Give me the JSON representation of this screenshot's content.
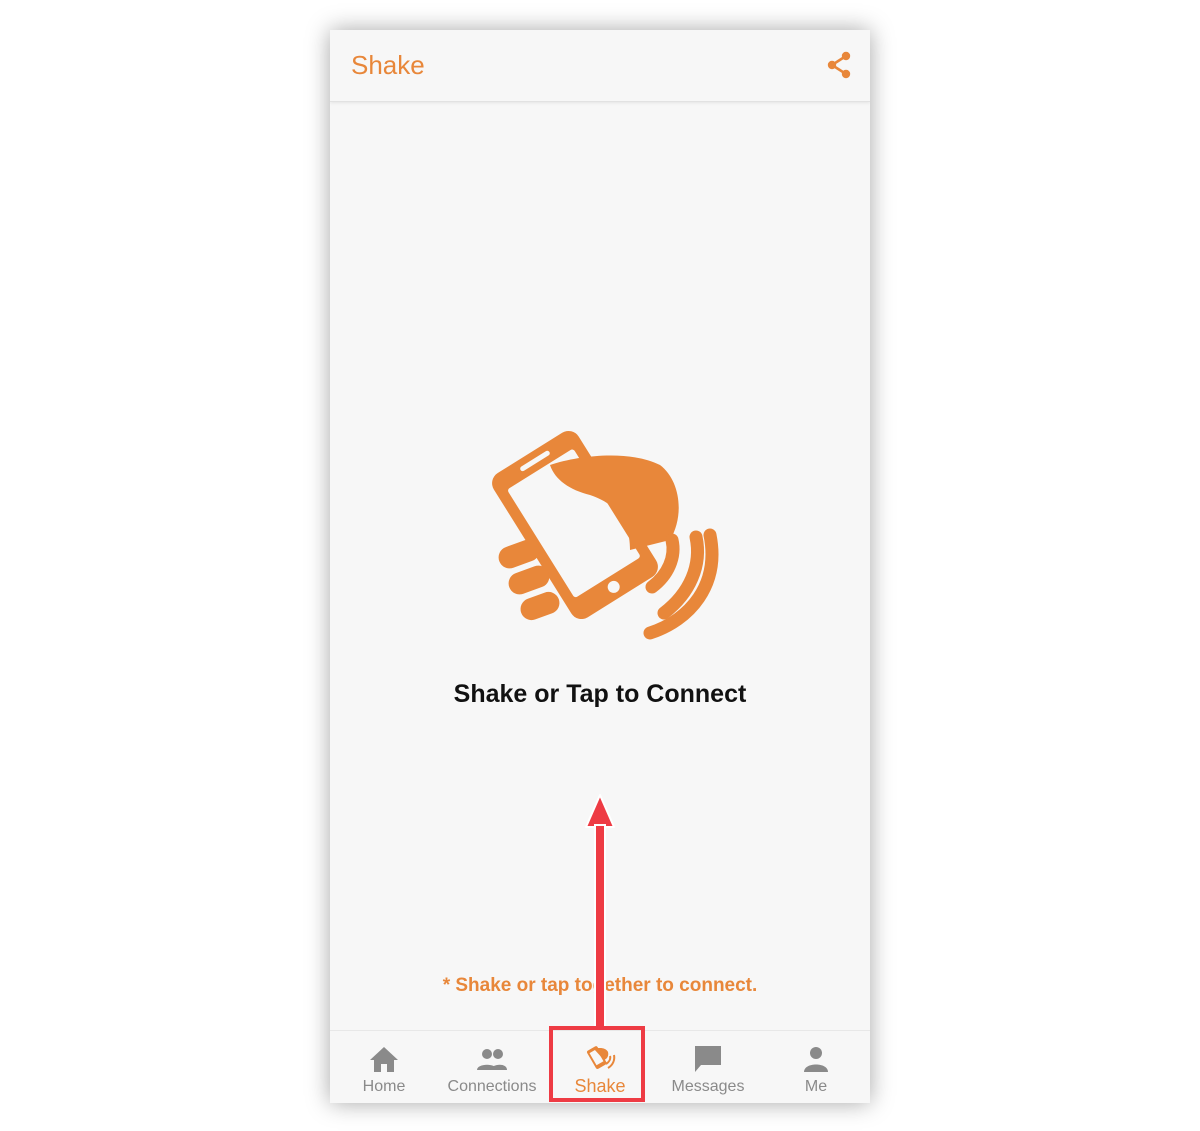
{
  "app_bar": {
    "title": "Shake",
    "share_icon": "share-icon"
  },
  "main": {
    "hero_icon": "hand-shaking-phone-icon",
    "headline": "Shake or Tap to Connect",
    "hint": "* Shake or tap together to connect."
  },
  "bottom_nav": {
    "items": [
      {
        "label": "Home",
        "icon": "home-icon"
      },
      {
        "label": "Connections",
        "icon": "people-icon"
      },
      {
        "label": "Shake",
        "icon": "shake-icon",
        "active": true
      },
      {
        "label": "Messages",
        "icon": "chat-icon"
      },
      {
        "label": "Me",
        "icon": "person-icon"
      }
    ]
  },
  "colors": {
    "accent": "#e8873a",
    "inactive": "#8a8a8a",
    "background": "#f7f7f7",
    "annotation": "#ee3b44"
  }
}
